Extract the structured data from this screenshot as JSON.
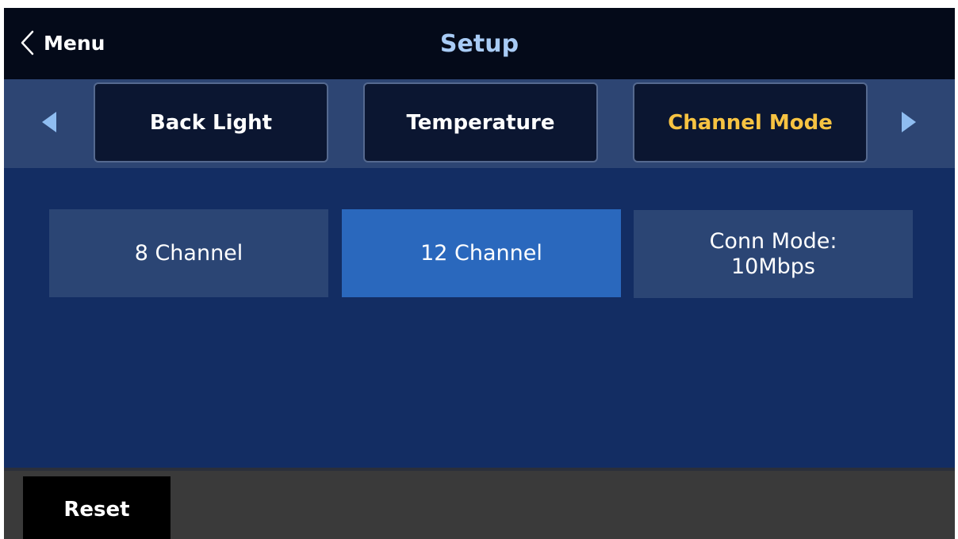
{
  "header": {
    "back_label": "Menu",
    "title": "Setup"
  },
  "tabs": [
    {
      "label": "Back Light",
      "selected": false
    },
    {
      "label": "Temperature",
      "selected": false
    },
    {
      "label": "Channel Mode",
      "selected": true
    }
  ],
  "nav_icons": {
    "back": "chevron-left-icon",
    "prev": "triangle-left-icon",
    "next": "triangle-right-icon"
  },
  "options": [
    {
      "line1": "8 Channel",
      "line2": "",
      "selected": false
    },
    {
      "line1": "12 Channel",
      "line2": "",
      "selected": true
    },
    {
      "line1": "Conn Mode:",
      "line2": "10Mbps",
      "selected": false
    }
  ],
  "footer": {
    "reset_label": "Reset"
  },
  "colors": {
    "background": "#132d63",
    "header_bg": "#040a19",
    "title": "#a8cbf5",
    "tabbar_bg": "#2d4573",
    "tab_bg": "#0b1631",
    "tab_active_text": "#f7c342",
    "option_bg": "#2b4574",
    "option_selected_bg": "#2a68bd",
    "footer_bg": "#3a3a3a",
    "arrow": "#8fbdf1"
  }
}
